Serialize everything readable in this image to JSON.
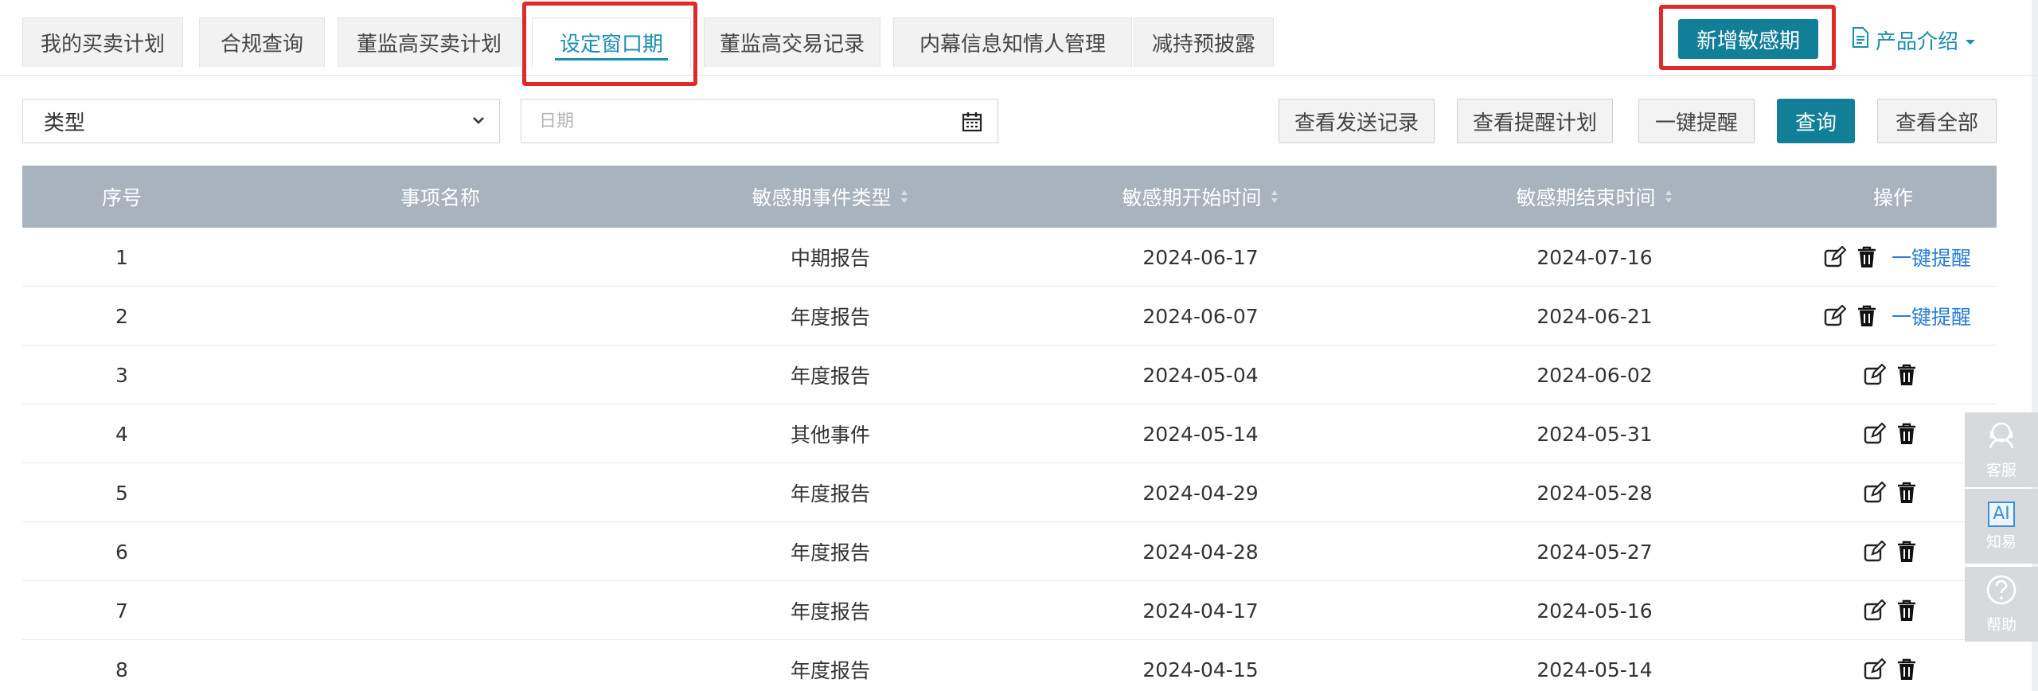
{
  "tabs": [
    {
      "label": "我的买卖计划"
    },
    {
      "label": "合规查询"
    },
    {
      "label": "董监高买卖计划"
    },
    {
      "label": "设定窗口期"
    },
    {
      "label": "董监高交易记录"
    },
    {
      "label": "内幕信息知情人管理"
    },
    {
      "label": "减持预披露"
    }
  ],
  "header": {
    "add_button_label": "新增敏感期",
    "product_intro_label": "产品介绍"
  },
  "filters": {
    "type_label": "类型",
    "date_placeholder": "日期"
  },
  "actions": {
    "view_send_records": "查看发送记录",
    "view_remind_plan": "查看提醒计划",
    "one_click_remind": "一键提醒",
    "query": "查询",
    "view_all": "查看全部"
  },
  "table": {
    "headers": {
      "index": "序号",
      "item_name": "事项名称",
      "event_type": "敏感期事件类型",
      "start_time": "敏感期开始时间",
      "end_time": "敏感期结束时间",
      "operation": "操作"
    },
    "remind_link": "一键提醒",
    "rows": [
      {
        "index": "1",
        "name": "",
        "type": "中期报告",
        "start": "2024-06-17",
        "end": "2024-07-16"
      },
      {
        "index": "2",
        "name": "",
        "type": "年度报告",
        "start": "2024-06-07",
        "end": "2024-06-21"
      },
      {
        "index": "3",
        "name": "",
        "type": "年度报告",
        "start": "2024-05-04",
        "end": "2024-06-02"
      },
      {
        "index": "4",
        "name": "",
        "type": "其他事件",
        "start": "2024-05-14",
        "end": "2024-05-31"
      },
      {
        "index": "5",
        "name": "",
        "type": "年度报告",
        "start": "2024-04-29",
        "end": "2024-05-28"
      },
      {
        "index": "6",
        "name": "",
        "type": "年度报告",
        "start": "2024-04-28",
        "end": "2024-05-27"
      },
      {
        "index": "7",
        "name": "",
        "type": "年度报告",
        "start": "2024-04-17",
        "end": "2024-05-16"
      },
      {
        "index": "8",
        "name": "",
        "type": "年度报告",
        "start": "2024-04-15",
        "end": "2024-05-14"
      }
    ]
  },
  "floating": {
    "service": "客服",
    "ai_badge": "AI",
    "ai": "知易",
    "help": "帮助"
  },
  "colors": {
    "accent": "#127f99",
    "highlight_box": "#e02a2a",
    "table_header": "#a8b3be",
    "link": "#2a7fd4"
  }
}
